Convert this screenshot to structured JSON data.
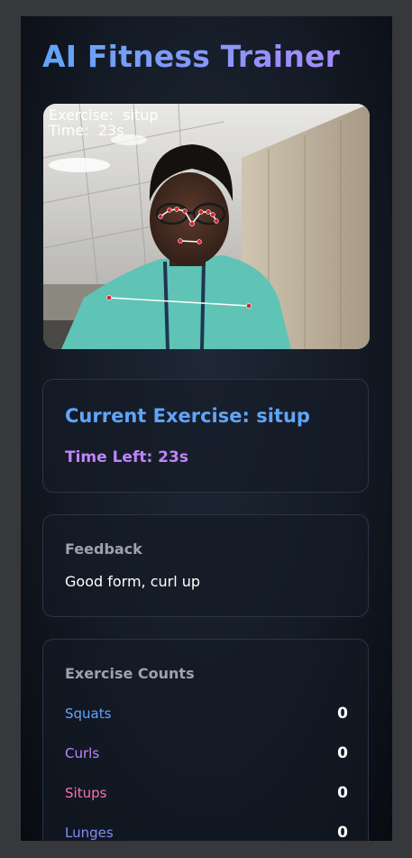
{
  "app": {
    "title": "AI Fitness Trainer"
  },
  "video": {
    "overlay_exercise": "Exercise:  situp",
    "overlay_time": "Time:  23s"
  },
  "current": {
    "exercise_label": "Current Exercise: situp",
    "time_left_label": "Time Left: 23s"
  },
  "feedback": {
    "heading": "Feedback",
    "text": "Good form, curl up"
  },
  "counts": {
    "heading": "Exercise Counts",
    "items": [
      {
        "name": "Squats",
        "value": "0",
        "color": "#60a5fa"
      },
      {
        "name": "Curls",
        "value": "0",
        "color": "#c084fc"
      },
      {
        "name": "Situps",
        "value": "0",
        "color": "#f472b6"
      },
      {
        "name": "Lunges",
        "value": "0",
        "color": "#818cf8"
      }
    ]
  },
  "colors": {
    "accent_blue": "#60a5fa",
    "accent_purple": "#c084fc",
    "landmark_red": "#e11d2a"
  }
}
